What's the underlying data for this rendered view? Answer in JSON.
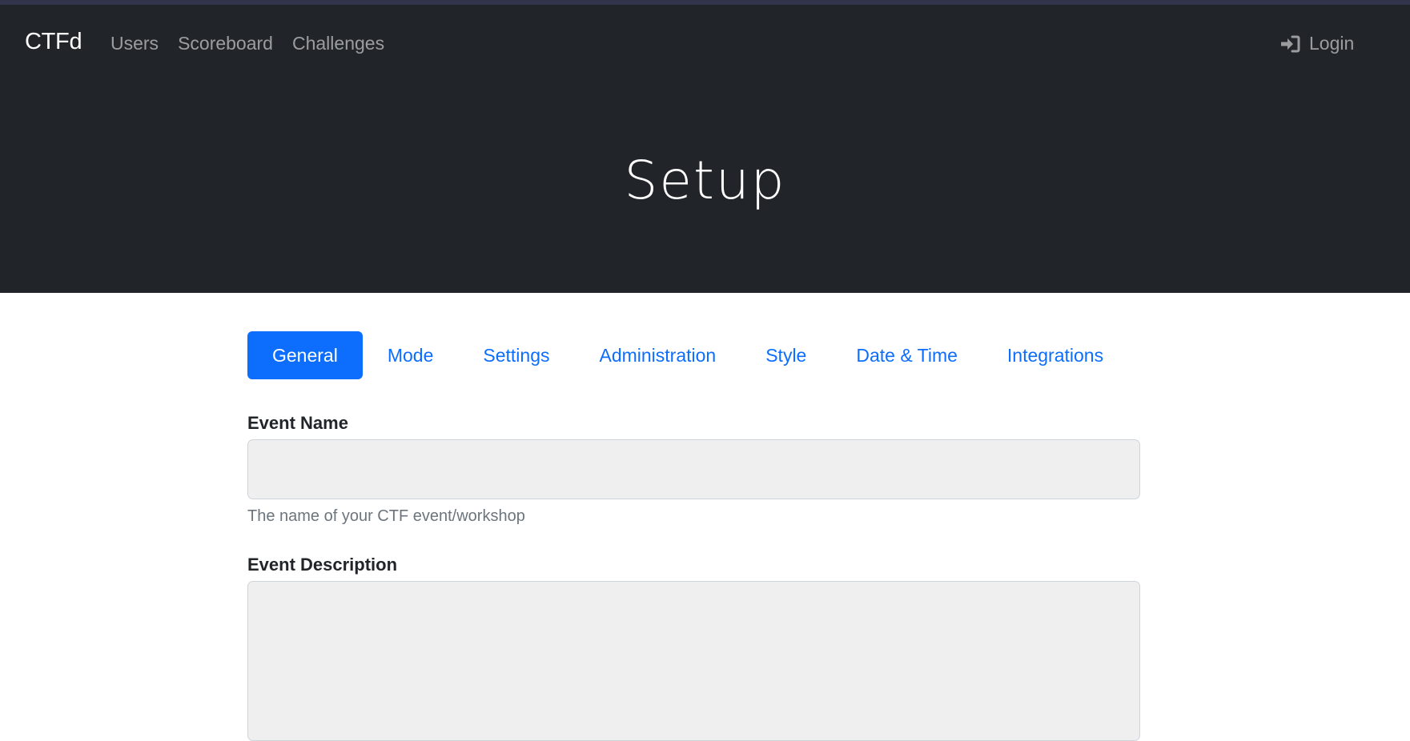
{
  "navbar": {
    "brand": "CTFd",
    "links": [
      {
        "label": "Users"
      },
      {
        "label": "Scoreboard"
      },
      {
        "label": "Challenges"
      }
    ],
    "login": {
      "label": "Login",
      "icon": "sign-in-icon"
    }
  },
  "hero": {
    "title": "Setup"
  },
  "tabs": [
    {
      "label": "General",
      "active": true
    },
    {
      "label": "Mode",
      "active": false
    },
    {
      "label": "Settings",
      "active": false
    },
    {
      "label": "Administration",
      "active": false
    },
    {
      "label": "Style",
      "active": false
    },
    {
      "label": "Date & Time",
      "active": false
    },
    {
      "label": "Integrations",
      "active": false
    }
  ],
  "form": {
    "event_name": {
      "label": "Event Name",
      "value": "",
      "placeholder": "",
      "help": "The name of your CTF event/workshop"
    },
    "event_description": {
      "label": "Event Description",
      "value": "",
      "placeholder": ""
    }
  },
  "colors": {
    "navbar_bg": "#212529",
    "accent": "#0d6efd",
    "input_bg": "#efefef",
    "help_text": "#6c757d"
  }
}
